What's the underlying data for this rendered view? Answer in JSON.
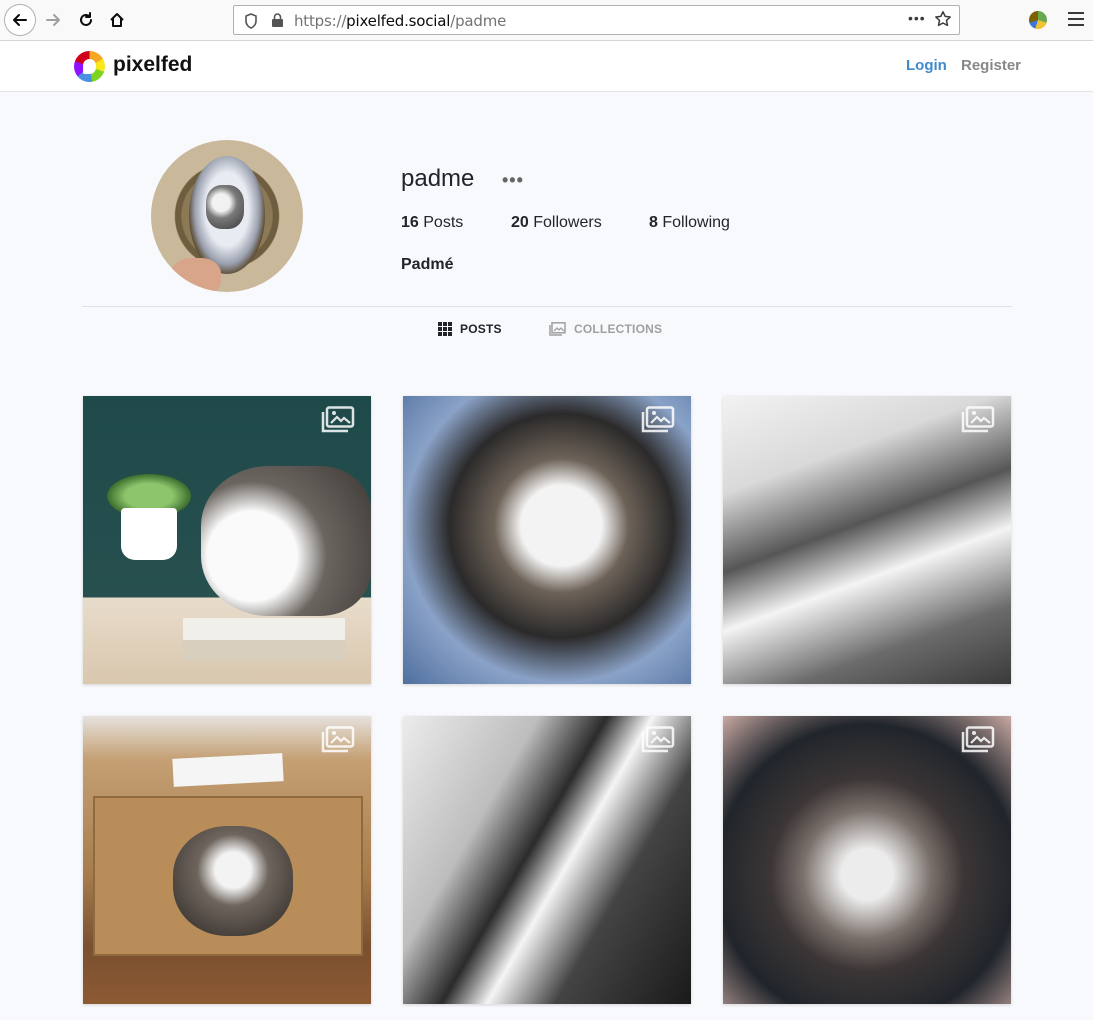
{
  "browser": {
    "url_prefix": "https://",
    "url_host": "pixelfed.social",
    "url_path": "/padme",
    "more_label": "•••"
  },
  "site": {
    "brand": "pixelfed",
    "login_label": "Login",
    "register_label": "Register",
    "accent_color": "#3d8acd"
  },
  "profile": {
    "username": "padme",
    "options_label": "•••",
    "posts_count": "16",
    "posts_label": "Posts",
    "followers_count": "20",
    "followers_label": "Followers",
    "following_count": "8",
    "following_label": "Following",
    "display_name": "Padmé"
  },
  "tabs": {
    "posts_label": "POSTS",
    "collections_label": "COLLECTIONS"
  },
  "grid": {
    "tiles": [
      {
        "icon": "album-icon"
      },
      {
        "icon": "album-icon"
      },
      {
        "icon": "album-icon"
      },
      {
        "icon": "album-icon"
      },
      {
        "icon": "album-icon"
      },
      {
        "icon": "album-icon"
      }
    ]
  }
}
